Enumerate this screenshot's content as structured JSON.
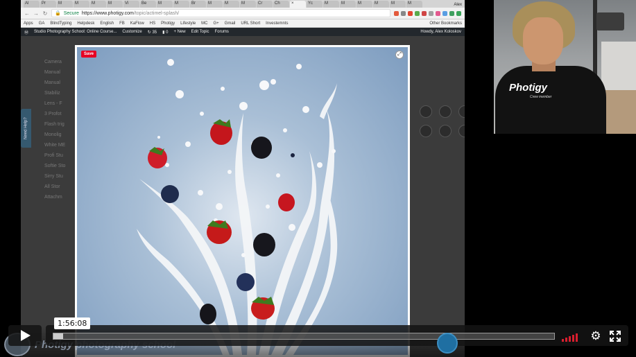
{
  "browser": {
    "tabs": [
      "Al",
      "Pr",
      "M",
      "M",
      "M",
      "M",
      "Vi",
      "Be",
      "M",
      "M",
      "Br",
      "M",
      "M",
      "M",
      "Cr",
      "Ch",
      "×",
      "Yc",
      "M",
      "M",
      "M",
      "M",
      "M",
      "M"
    ],
    "user": "Alex",
    "secure_label": "Secure",
    "url_host": "https://www.photigy.com",
    "url_path": "/topic/actimel-splash/",
    "bookmarks": [
      "Apps",
      "GA",
      "BlindTyping",
      "Helpdesk",
      "English",
      "FB",
      "KaFlow",
      "HS",
      "Photigy",
      "Lifestyle",
      "MC",
      "G+",
      "Gmail",
      "URL Short",
      "Investemnts"
    ],
    "other_bookmarks": "Other Bookmarks"
  },
  "adminbar": {
    "site": "Studio Photography School: Online Course...",
    "customize": "Customize",
    "updates": "35",
    "comments": "0",
    "new": "+ New",
    "edit": "Edit Topic",
    "forums": "Forums",
    "howdy": "Howdy, Alex Koloskov"
  },
  "page": {
    "left_items": [
      "Camera",
      "Manual",
      "Manual",
      "Stabiliz",
      "Lens - F",
      "3 Profot",
      "Flash trig",
      "Monolig",
      "White ME",
      "Profi Stu",
      "Softie Sto",
      "Sirry Stu",
      "All Stor",
      "Attachm"
    ],
    "help_tab": "Need Help?"
  },
  "lightbox": {
    "save_label": "Save",
    "expand_icon": "⤢"
  },
  "webcam": {
    "shirt_logo": "Photigy",
    "shirt_sub": "Crew member"
  },
  "player": {
    "time": "1:56:08",
    "progress": 0.02,
    "watermark": "Photigy photography school",
    "settings_icon": "⚙"
  },
  "colors": {
    "accent": "#d81e2e",
    "save": "#e60023",
    "admin": "#23282d"
  }
}
